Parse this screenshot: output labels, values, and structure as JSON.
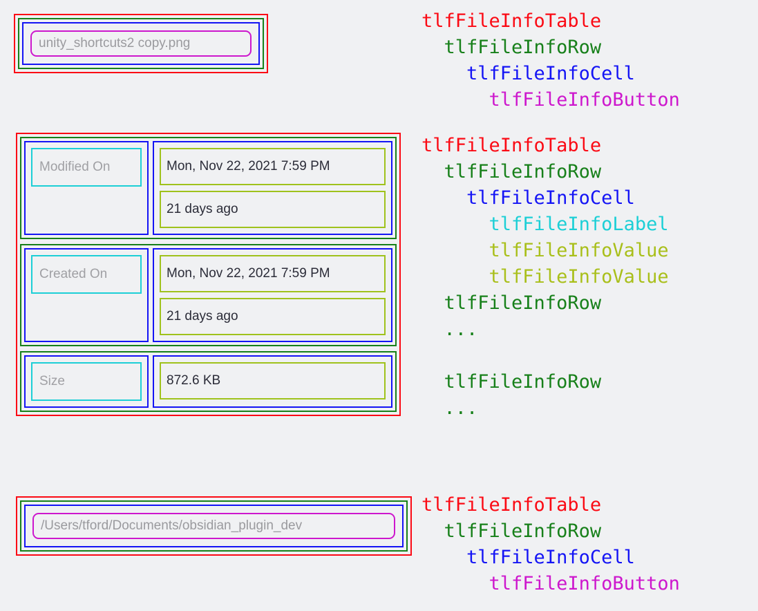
{
  "colors": {
    "background": "#f0f1f3",
    "table": "#fb0a14",
    "row": "#17801a",
    "cell": "#1414f5",
    "button": "#cd17cd",
    "label": "#1ccfd6",
    "value": "#a9bf1a",
    "label_text": "#a0a0a4",
    "value_text": "#2b2c38"
  },
  "filename_table": {
    "button_label": "unity_shortcuts2 copy.png"
  },
  "info_table": {
    "rows": [
      {
        "label": "Modified On",
        "values": [
          "Mon, Nov 22, 2021 7:59 PM",
          "21 days ago"
        ]
      },
      {
        "label": "Created On",
        "values": [
          "Mon, Nov 22, 2021 7:59 PM",
          "21 days ago"
        ]
      },
      {
        "label": "Size",
        "values": [
          "872.6 KB"
        ]
      }
    ]
  },
  "path_table": {
    "button_label": "/Users/tford/Documents/obsidian_plugin_dev"
  },
  "legend_1": {
    "lines": [
      {
        "text": "tlfFileInfoTable",
        "indent": 0,
        "cls": "lg-table"
      },
      {
        "text": "tlfFileInfoRow",
        "indent": 1,
        "cls": "lg-row"
      },
      {
        "text": "tlfFileInfoCell",
        "indent": 2,
        "cls": "lg-cell"
      },
      {
        "text": "tlfFileInfoButton",
        "indent": 3,
        "cls": "lg-button"
      }
    ]
  },
  "legend_2": {
    "lines": [
      {
        "text": "tlfFileInfoTable",
        "indent": 0,
        "cls": "lg-table"
      },
      {
        "text": "tlfFileInfoRow",
        "indent": 1,
        "cls": "lg-row"
      },
      {
        "text": "tlfFileInfoCell",
        "indent": 2,
        "cls": "lg-cell"
      },
      {
        "text": "tlfFileInfoLabel",
        "indent": 3,
        "cls": "lg-label"
      },
      {
        "text": "tlfFileInfoValue",
        "indent": 3,
        "cls": "lg-value"
      },
      {
        "text": "tlfFileInfoValue",
        "indent": 3,
        "cls": "lg-value"
      },
      {
        "text": "tlfFileInfoRow",
        "indent": 1,
        "cls": "lg-row"
      },
      {
        "text": "...",
        "indent": 1,
        "cls": "lg-dots"
      },
      {
        "text": "",
        "indent": 0,
        "cls": "lg-dots"
      },
      {
        "text": "tlfFileInfoRow",
        "indent": 1,
        "cls": "lg-row"
      },
      {
        "text": "...",
        "indent": 1,
        "cls": "lg-dots"
      }
    ]
  },
  "legend_3": {
    "lines": [
      {
        "text": "tlfFileInfoTable",
        "indent": 0,
        "cls": "lg-table"
      },
      {
        "text": "tlfFileInfoRow",
        "indent": 1,
        "cls": "lg-row"
      },
      {
        "text": "tlfFileInfoCell",
        "indent": 2,
        "cls": "lg-cell"
      },
      {
        "text": "tlfFileInfoButton",
        "indent": 3,
        "cls": "lg-button"
      }
    ]
  }
}
